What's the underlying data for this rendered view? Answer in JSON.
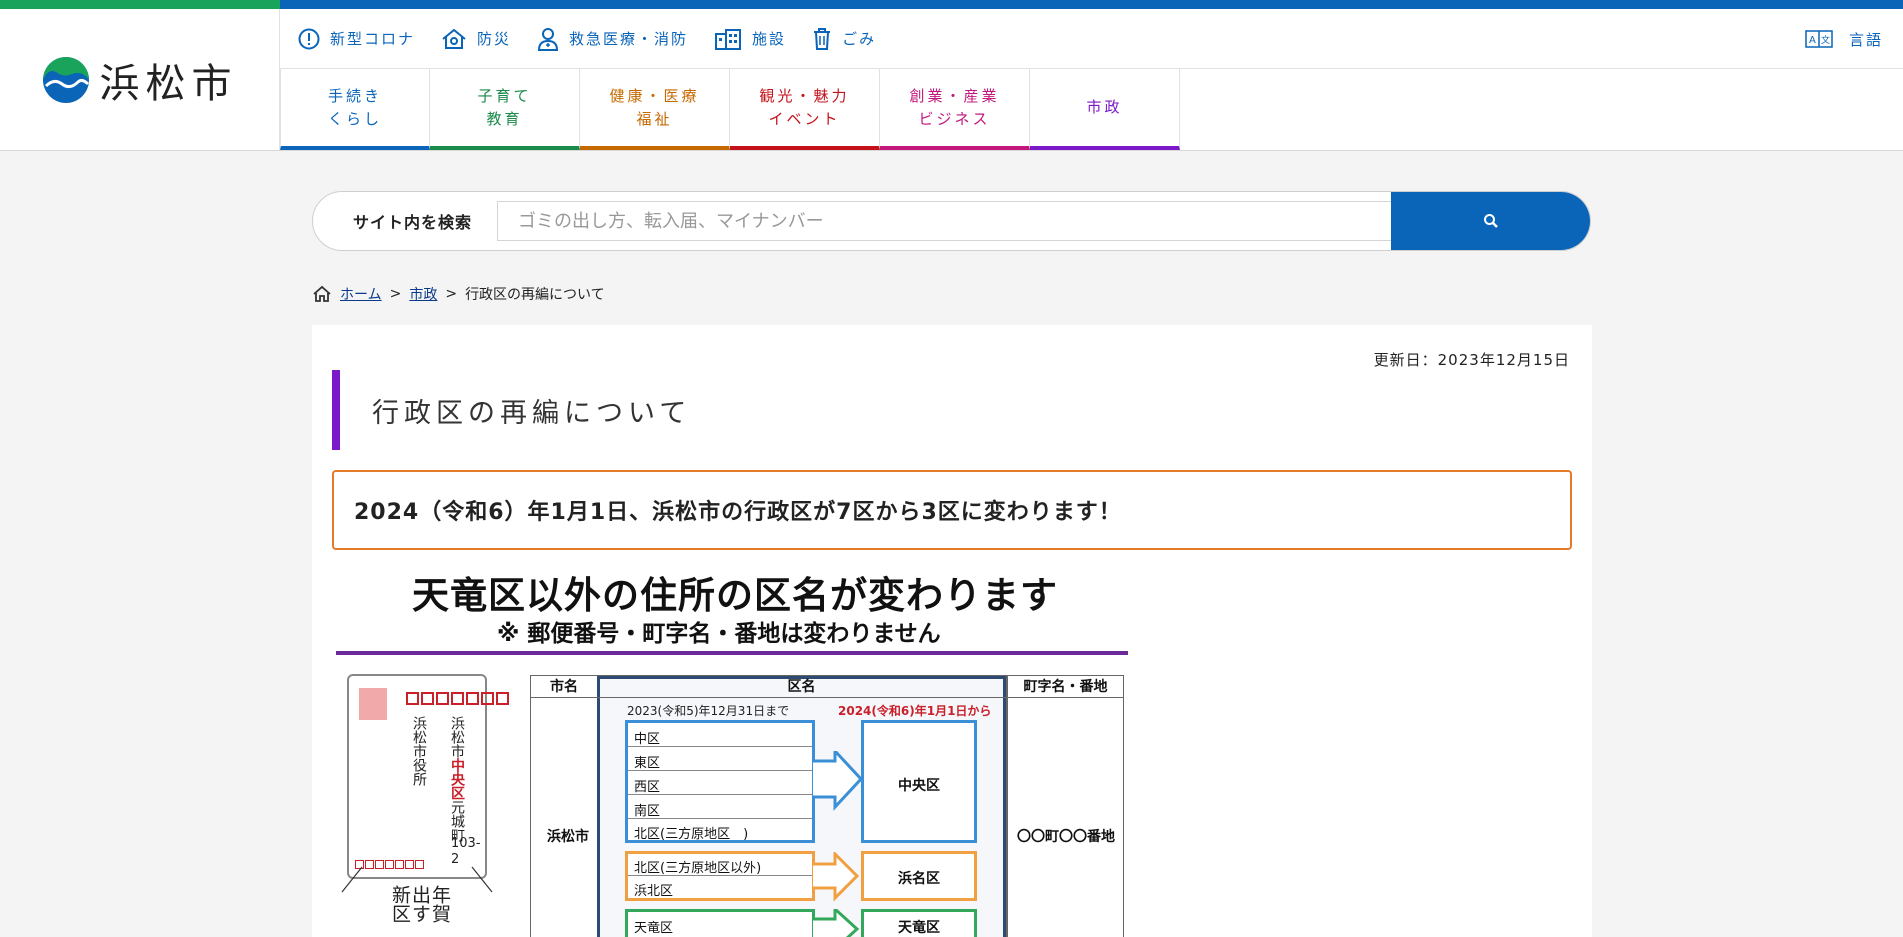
{
  "site": {
    "logo_text": "浜松市"
  },
  "utility_nav": [
    {
      "label": "新型コロナ",
      "icon": "info-circle-icon"
    },
    {
      "label": "防災",
      "icon": "house-shield-icon"
    },
    {
      "label": "救急医療・消防",
      "icon": "doctor-icon"
    },
    {
      "label": "施設",
      "icon": "building-icon"
    },
    {
      "label": "ごみ",
      "icon": "trash-icon"
    }
  ],
  "language": {
    "label": "言語",
    "icon": "translate-icon"
  },
  "global_nav": [
    {
      "label": "手続き\nくらし",
      "color": "#0a64b8"
    },
    {
      "label": "子育て\n教育",
      "color": "#1a8a4a"
    },
    {
      "label": "健康・医療\n福祉",
      "color": "#c66a00"
    },
    {
      "label": "観光・魅力\nイベント",
      "color": "#c4121a"
    },
    {
      "label": "創業・産業\nビジネス",
      "color": "#c2187e"
    },
    {
      "label": "市政",
      "color": "#7b19c8"
    }
  ],
  "search": {
    "label": "サイト内を検索",
    "placeholder": "ゴミの出し方、転入届、マイナンバー",
    "value": "",
    "button_icon": "search-icon"
  },
  "breadcrumb": {
    "home": "ホーム",
    "sep": ">",
    "parent": "市政",
    "current": "行政区の再編について"
  },
  "page": {
    "updated": "更新日：2023年12月15日",
    "title": "行政区の再編について",
    "notice": "2024（令和6）年1月1日、浜松市の行政区が7区から3区に変わります！"
  },
  "infographic": {
    "title": "天竜区以外の住所の区名が変わります",
    "subtitle": "※ 郵便番号・町字名・番地は変わりません",
    "postcard": {
      "address_line": [
        "浜松市",
        "中央区",
        "元城町"
      ],
      "number": "103-2",
      "recipient": "浜松市役所"
    },
    "nenga": [
      "年賀",
      "出す",
      "新区"
    ],
    "table": {
      "col_city": "市名",
      "col_ku": "区名",
      "col_town": "町字名・番地",
      "label_old": "2023(令和5)年12月31日まで",
      "label_new": "2024(令和6)年1月1日から",
      "city": "浜松市",
      "town": "〇〇町〇〇番地",
      "groups": [
        {
          "old": [
            "中区",
            "東区",
            "西区",
            "南区",
            "北区(三方原地区　)"
          ],
          "new": "中央区",
          "color": "#3a8fd6"
        },
        {
          "old": [
            "北区(三方原地区以外)",
            "浜北区"
          ],
          "new": "浜名区",
          "color": "#f0a040"
        },
        {
          "old": [
            "天竜区"
          ],
          "new": "天竜区",
          "color": "#34a85a"
        }
      ]
    }
  },
  "colors": {
    "brand_blue": "#0a64b8",
    "brand_green": "#1aa35a",
    "accent_purple": "#7b19c8",
    "notice_orange": "#e57b2a"
  }
}
